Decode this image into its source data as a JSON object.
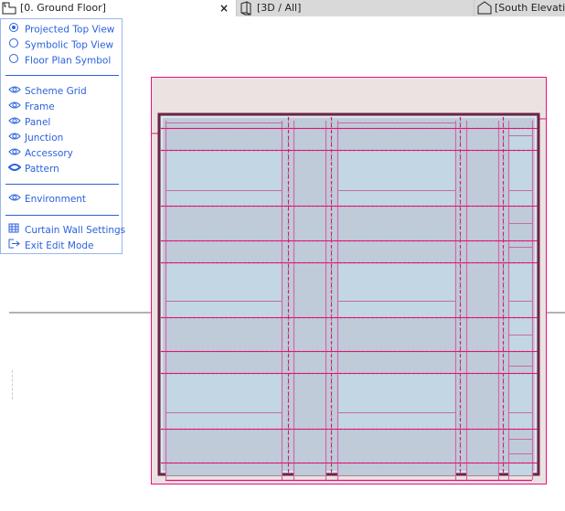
{
  "tabs": [
    {
      "label": "[0. Ground Floor]",
      "icon": "floor-plan-icon",
      "active": true
    },
    {
      "label": "[3D / All]",
      "icon": "3d-box-icon",
      "active": false
    },
    {
      "label": "[South Elevation]",
      "icon": "elevation-icon",
      "active": false
    }
  ],
  "close_label": "×",
  "menu": {
    "view_options": [
      {
        "label": "Projected Top View",
        "selected": true
      },
      {
        "label": "Symbolic Top View",
        "selected": false
      },
      {
        "label": "Floor Plan Symbol",
        "selected": false
      }
    ],
    "visibility": [
      {
        "label": "Scheme Grid",
        "icon": "eye-icon"
      },
      {
        "label": "Frame",
        "icon": "eye-icon"
      },
      {
        "label": "Panel",
        "icon": "eye-icon"
      },
      {
        "label": "Junction",
        "icon": "eye-icon"
      },
      {
        "label": "Accessory",
        "icon": "eye-icon"
      },
      {
        "label": "Pattern",
        "icon": "eye-closed-icon"
      }
    ],
    "environment": {
      "label": "Environment",
      "icon": "eye-icon"
    },
    "settings": {
      "label": "Curtain Wall Settings",
      "icon": "settings-grid-icon"
    },
    "exit": {
      "label": "Exit Edit Mode",
      "icon": "exit-icon"
    }
  },
  "colors": {
    "menu_text": "#2b62dc",
    "pink": "#e8107a",
    "frame": "#6b2444",
    "panel_light": "#c3d6e3",
    "panel_dark": "#c0cbda",
    "bg": "#ebe3e2"
  }
}
